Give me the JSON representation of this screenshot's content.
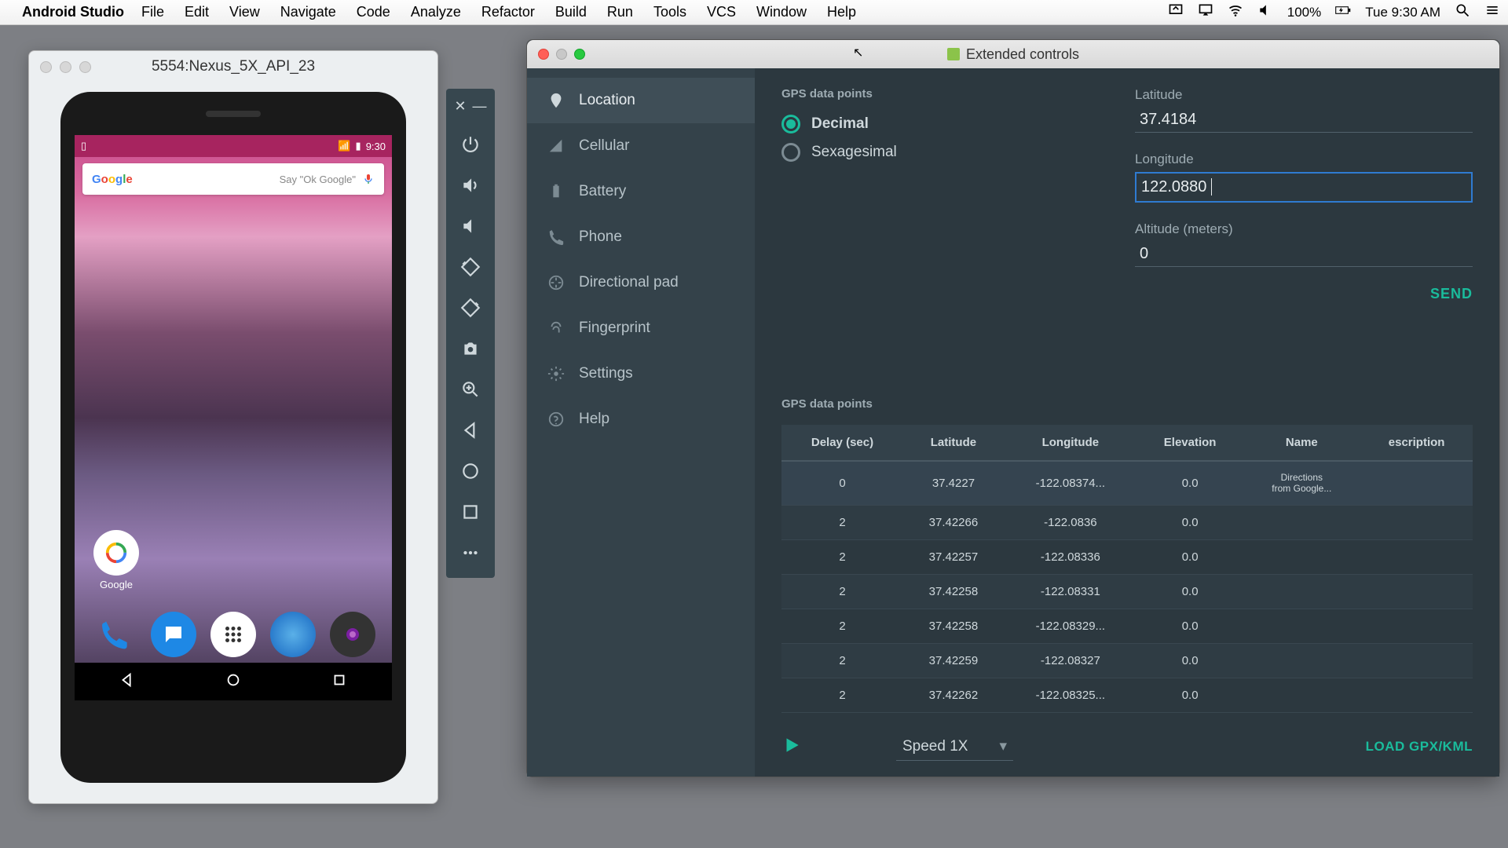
{
  "menubar": {
    "app": "Android Studio",
    "items": [
      "File",
      "Edit",
      "View",
      "Navigate",
      "Code",
      "Analyze",
      "Refactor",
      "Build",
      "Run",
      "Tools",
      "VCS",
      "Window",
      "Help"
    ],
    "battery": "100%",
    "clock": "Tue 9:30 AM"
  },
  "emulator": {
    "title": "5554:Nexus_5X_API_23",
    "status_time": "9:30",
    "search_hint": "Say \"Ok Google\"",
    "google_label": "Google"
  },
  "ext": {
    "title": "Extended controls",
    "sidebar": [
      {
        "label": "Location",
        "icon": "location"
      },
      {
        "label": "Cellular",
        "icon": "cellular"
      },
      {
        "label": "Battery",
        "icon": "battery"
      },
      {
        "label": "Phone",
        "icon": "phone"
      },
      {
        "label": "Directional pad",
        "icon": "dpad"
      },
      {
        "label": "Fingerprint",
        "icon": "fingerprint"
      },
      {
        "label": "Settings",
        "icon": "settings"
      },
      {
        "label": "Help",
        "icon": "help"
      }
    ],
    "gps_section": "GPS data points",
    "radio_decimal": "Decimal",
    "radio_sexagesimal": "Sexagesimal",
    "lat_label": "Latitude",
    "lat_value": "37.4184",
    "lon_label": "Longitude",
    "lon_value": "122.0880",
    "alt_label": "Altitude (meters)",
    "alt_value": "0",
    "send": "SEND",
    "gps_section2": "GPS data points",
    "cols": [
      "Delay (sec)",
      "Latitude",
      "Longitude",
      "Elevation",
      "Name",
      "escription"
    ],
    "rows": [
      {
        "delay": "0",
        "lat": "37.4227",
        "lon": "-122.08374...",
        "elev": "0.0",
        "name": "Directions from Google...",
        "desc": ""
      },
      {
        "delay": "2",
        "lat": "37.42266",
        "lon": "-122.0836",
        "elev": "0.0",
        "name": "",
        "desc": ""
      },
      {
        "delay": "2",
        "lat": "37.42257",
        "lon": "-122.08336",
        "elev": "0.0",
        "name": "",
        "desc": ""
      },
      {
        "delay": "2",
        "lat": "37.42258",
        "lon": "-122.08331",
        "elev": "0.0",
        "name": "",
        "desc": ""
      },
      {
        "delay": "2",
        "lat": "37.42258",
        "lon": "-122.08329...",
        "elev": "0.0",
        "name": "",
        "desc": ""
      },
      {
        "delay": "2",
        "lat": "37.42259",
        "lon": "-122.08327",
        "elev": "0.0",
        "name": "",
        "desc": ""
      },
      {
        "delay": "2",
        "lat": "37.42262",
        "lon": "-122.08325...",
        "elev": "0.0",
        "name": "",
        "desc": ""
      }
    ],
    "speed": "Speed 1X",
    "load": "LOAD GPX/KML"
  }
}
